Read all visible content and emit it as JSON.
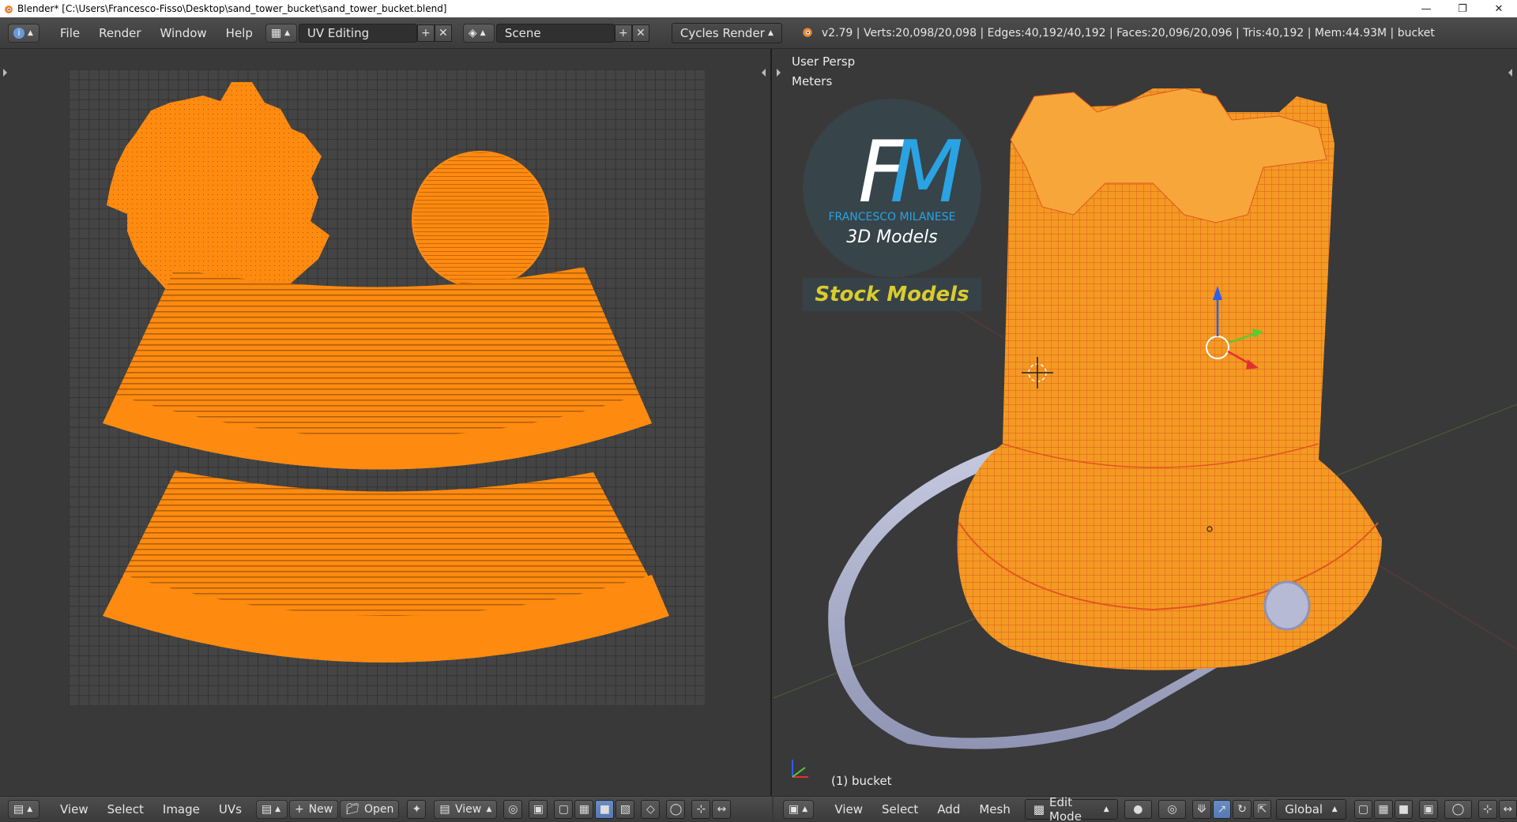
{
  "titlebar": {
    "title": "Blender* [C:\\Users\\Francesco-Fisso\\Desktop\\sand_tower_bucket\\sand_tower_bucket.blend]",
    "minimize": "—",
    "restore": "❐",
    "close": "✕"
  },
  "topbar": {
    "menus": [
      "File",
      "Render",
      "Window",
      "Help"
    ],
    "screen_layout": "UV Editing",
    "scene": "Scene",
    "render_engine": "Cycles Render",
    "stats": "v2.79 | Verts:20,098/20,098 | Edges:40,192/40,192 | Faces:20,096/20,096 | Tris:40,192 | Mem:44.93M | bucket"
  },
  "viewport": {
    "view_name": "User Persp",
    "units": "Meters",
    "object_label": "(1) bucket",
    "watermark": {
      "initials_f": "F",
      "initials_m": "M",
      "name": "FRANCESCO MILANESE",
      "sub": "3D Models",
      "stock": "Stock Models"
    },
    "colors": {
      "mesh": "#f39a23",
      "wire": "#e0561f",
      "handle": "#a9aecb",
      "axis_x": "#e23030",
      "axis_y": "#55cc33",
      "axis_z": "#2c5fe8"
    }
  },
  "uv_bottom": {
    "menus": [
      "View",
      "Select",
      "Image",
      "UVs"
    ],
    "new_label": "New",
    "open_label": "Open",
    "view_label": "View"
  },
  "vp_bottom": {
    "menus": [
      "View",
      "Select",
      "Add",
      "Mesh"
    ],
    "mode": "Edit Mode",
    "orientation": "Global"
  }
}
